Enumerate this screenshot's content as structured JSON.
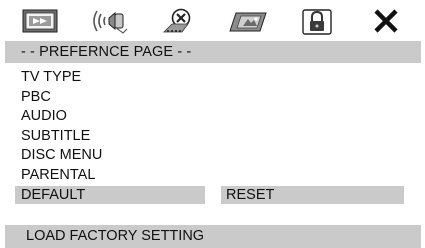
{
  "icon_bar": {
    "tabs": [
      {
        "icon": "general-setup-icon"
      },
      {
        "icon": "audio-setup-icon"
      },
      {
        "icon": "dolby-digital-setup-icon"
      },
      {
        "icon": "video-setup-icon"
      },
      {
        "icon": "preference-lock-icon"
      },
      {
        "icon": "exit-x-icon"
      }
    ]
  },
  "header": {
    "title": "- - PREFERNCE PAGE - -"
  },
  "menu": {
    "items": [
      {
        "label": "TV TYPE"
      },
      {
        "label": "PBC"
      },
      {
        "label": "AUDIO"
      },
      {
        "label": "SUBTITLE"
      },
      {
        "label": "DISC MENU"
      },
      {
        "label": "PARENTAL"
      },
      {
        "label": "DEFAULT",
        "selected": true,
        "option": "RESET"
      }
    ]
  },
  "status": {
    "text": "LOAD FACTORY SETTING"
  },
  "colors": {
    "highlight": "#cacaca",
    "background": "#ffffff",
    "text": "#111111"
  }
}
